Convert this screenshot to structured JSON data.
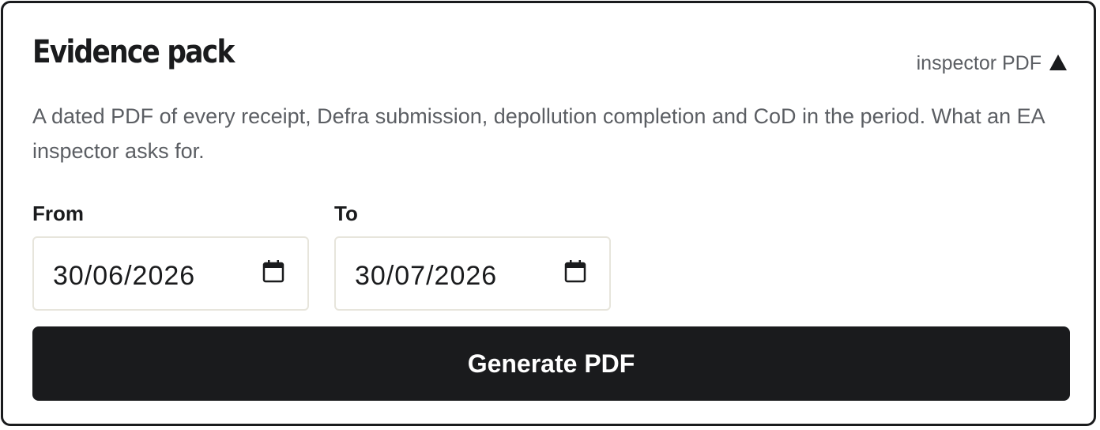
{
  "card": {
    "title": "Evidence pack",
    "tag": {
      "label": "inspector PDF",
      "icon": "triangle-warning-icon"
    },
    "description": "A dated PDF of every receipt, Defra submission, depollution completion and CoD in the period. What an EA inspector asks for."
  },
  "form": {
    "from": {
      "label": "From",
      "value": "30/06/2026",
      "icon": "calendar-icon"
    },
    "to": {
      "label": "To",
      "value": "30/07/2026",
      "icon": "calendar-icon"
    }
  },
  "actions": {
    "generate_label": "Generate PDF"
  },
  "colors": {
    "primary": "#1a1b1d",
    "muted_text": "#5b5e63",
    "input_border": "#e7e5dc",
    "background": "#ffffff"
  }
}
